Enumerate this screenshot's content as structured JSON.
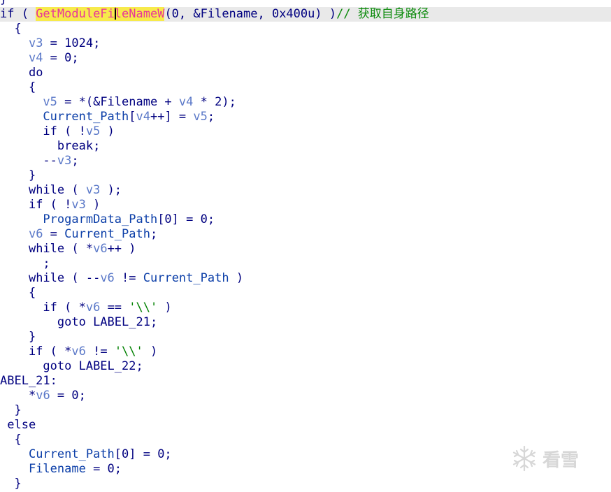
{
  "code": {
    "top_brace": "}",
    "l0": {
      "a": "if ( ",
      "fn_a": "GetModuleFi",
      "fn_b": "leNameW",
      "b": "(0, &Filename, 0x400u) )",
      "comment": "// 获取自身路径"
    },
    "l1": "{",
    "l2": {
      "v": "v3",
      "rest": " = 1024;"
    },
    "l3": {
      "v": "v4",
      "rest": " = 0;"
    },
    "l4": "do",
    "l5": "{",
    "l6": {
      "v5": "v5",
      "mid": " = *(&Filename + ",
      "v4": "v4",
      "end": " * 2);"
    },
    "l7": {
      "g": "Current_Path",
      "a": "[",
      "v4": "v4",
      "b": "++] = ",
      "v5": "v5",
      "c": ";"
    },
    "l8": {
      "a": "if ( !",
      "v": "v5",
      "b": " )"
    },
    "l9": "break;",
    "l10": {
      "a": "--",
      "v": "v3",
      "b": ";"
    },
    "l11": "}",
    "l12": {
      "a": "while ( ",
      "v": "v3",
      "b": " );"
    },
    "l13": {
      "a": "if ( !",
      "v": "v3",
      "b": " )"
    },
    "l14": {
      "g": "ProgarmData_Path",
      "rest": "[0] = 0;"
    },
    "l15": {
      "v": "v6",
      "a": " = ",
      "g": "Current_Path",
      "b": ";"
    },
    "l16": {
      "a": "while ( *",
      "v": "v6",
      "b": "++ )"
    },
    "l17": ";",
    "l18": {
      "a": "while ( --",
      "v": "v6",
      "b": " != ",
      "g": "Current_Path",
      "c": " )"
    },
    "l19": "{",
    "l20": {
      "a": "if ( *",
      "v": "v6",
      "b": " == ",
      "s": "'\\\\'",
      "c": " )"
    },
    "l21": "goto LABEL_21;",
    "l22": "}",
    "l23": {
      "a": "if ( *",
      "v": "v6",
      "b": " != ",
      "s": "'\\\\'",
      "c": " )"
    },
    "l24": "goto LABEL_22;",
    "l25": "ABEL_21:",
    "l26": {
      "a": "*",
      "v": "v6",
      "b": " = 0;"
    },
    "l27": "}",
    "l28": "else",
    "l29": "{",
    "l30": {
      "g": "Current_Path",
      "rest": "[0] = 0;"
    },
    "l31": {
      "g": "Filename",
      "rest": " = 0;"
    },
    "l32": "}"
  },
  "watermark": {
    "text": "看雪",
    "icon": "snowflake-logo-icon"
  }
}
